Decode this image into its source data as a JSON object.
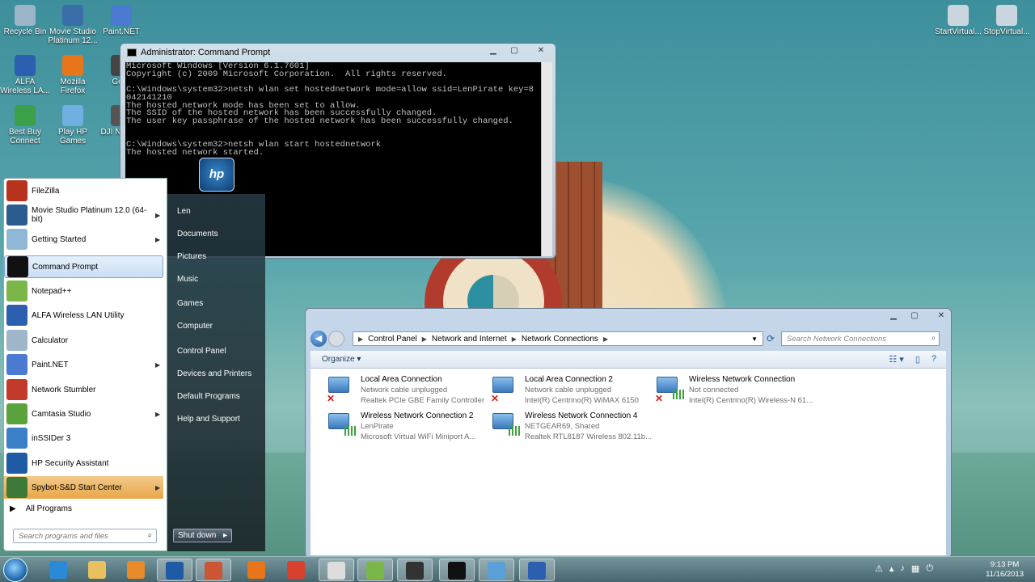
{
  "desktop": {
    "icons": [
      {
        "label": "Recycle Bin",
        "color": "#9ab4c8"
      },
      {
        "label": "Movie Studio Platinum 12...",
        "color": "#3a6ea8"
      },
      {
        "label": "Paint.NET",
        "color": "#4a7bd0"
      },
      {
        "label": "ALFA Wireless LA...",
        "color": "#2c5fb0"
      },
      {
        "label": "Mozilla Firefox",
        "color": "#e8751a"
      },
      {
        "label": "GoPr",
        "color": "#444444"
      },
      {
        "label": "Best Buy Connect",
        "color": "#3aa04a"
      },
      {
        "label": "Play HP Games",
        "color": "#6fb0e0"
      },
      {
        "label": "DJI N Assis",
        "color": "#555555"
      },
      {
        "label": "StartVirtual...",
        "color": "#c9d6e0"
      },
      {
        "label": "StopVirtual...",
        "color": "#c9d6e0"
      }
    ]
  },
  "cmd": {
    "title": "Administrator: Command Prompt",
    "minimize": "▁",
    "maximize": "▢",
    "close": "✕",
    "lines": "Microsoft Windows [Version 6.1.7601]\nCopyright (c) 2009 Microsoft Corporation.  All rights reserved.\n\nC:\\Windows\\system32>netsh wlan set hostednetwork mode=allow ssid=LenPirate key=8\n042141210\nThe hosted network mode has been set to allow.\nThe SSID of the hosted network has been successfully changed.\nThe user key passphrase of the hosted network has been successfully changed.\n\n\nC:\\Windows\\system32>netsh wlan start hostednetwork\nThe hosted network started."
  },
  "start_menu": {
    "pinned": [
      {
        "label": "FileZilla",
        "color": "#b8331e",
        "arrow": ""
      },
      {
        "label": "Movie Studio Platinum 12.0 (64-bit)",
        "color": "#2b5c8e",
        "arrow": "▶"
      },
      {
        "label": "Getting Started",
        "color": "#8fb7d6",
        "arrow": "▶"
      },
      {
        "label": "Command Prompt",
        "color": "#111111",
        "arrow": ""
      },
      {
        "label": "Notepad++",
        "color": "#7ab648",
        "arrow": ""
      },
      {
        "label": "ALFA Wireless LAN Utility",
        "color": "#2c5fb0",
        "arrow": ""
      },
      {
        "label": "Calculator",
        "color": "#9fb6c9",
        "arrow": ""
      },
      {
        "label": "Paint.NET",
        "color": "#4a7bd0",
        "arrow": "▶"
      },
      {
        "label": "Network Stumbler",
        "color": "#c23a2a",
        "arrow": ""
      },
      {
        "label": "Camtasia Studio",
        "color": "#5aa33c",
        "arrow": "▶"
      },
      {
        "label": "inSSIDer 3",
        "color": "#3a7fc8",
        "arrow": ""
      },
      {
        "label": "HP Security Assistant",
        "color": "#1f5aa5",
        "arrow": ""
      },
      {
        "label": "Spybot-S&D Start Center",
        "color": "#3d7a3a",
        "arrow": "▶"
      }
    ],
    "all_programs": "All Programs",
    "search_placeholder": "Search programs and files",
    "right": [
      "Len",
      "Documents",
      "Pictures",
      "Music",
      "Games",
      "Computer",
      "Control Panel",
      "Devices and Printers",
      "Default Programs",
      "Help and Support"
    ],
    "shutdown": "Shut down",
    "hp_logo_text": "hp"
  },
  "network": {
    "breadcrumb": [
      "Control Panel",
      "Network and Internet",
      "Network Connections"
    ],
    "search_placeholder": "Search Network Connections",
    "organize": "Organize",
    "connections": [
      {
        "name": "Local Area Connection",
        "status": "Network cable unplugged",
        "device": "Realtek PCIe GBE Family Controller",
        "state": "x"
      },
      {
        "name": "Local Area Connection 2",
        "status": "Network cable unplugged",
        "device": "Intel(R) Centrino(R) WiMAX 6150",
        "state": "x"
      },
      {
        "name": "Wireless Network Connection",
        "status": "Not connected",
        "device": "Intel(R) Centrino(R) Wireless-N 61...",
        "state": "x-sig"
      },
      {
        "name": "Wireless Network Connection 2",
        "status": "LenPirate",
        "device": "Microsoft Virtual WiFi Miniport A...",
        "state": "sig"
      },
      {
        "name": "Wireless Network Connection 4",
        "status": "NETGEAR69, Shared",
        "device": "Realtek RTL8187 Wireless 802.11b...",
        "state": "sig"
      }
    ]
  },
  "taskbar": {
    "apps": [
      {
        "name": "internet-explorer",
        "color": "#2a8ad8"
      },
      {
        "name": "explorer",
        "color": "#e8c060"
      },
      {
        "name": "media-player",
        "color": "#e88a2a"
      },
      {
        "name": "hp",
        "color": "#1f5aa5"
      },
      {
        "name": "printer",
        "color": "#cc5533"
      },
      {
        "name": "firefox",
        "color": "#e8751a"
      },
      {
        "name": "chrome",
        "color": "#d9412e"
      },
      {
        "name": "notepad",
        "color": "#dddddd"
      },
      {
        "name": "camtasia",
        "color": "#7ab648"
      },
      {
        "name": "dji",
        "color": "#333333"
      },
      {
        "name": "cmd",
        "color": "#111111"
      },
      {
        "name": "network",
        "color": "#5aa0d8"
      },
      {
        "name": "alfa",
        "color": "#2c5fb0"
      }
    ],
    "time": "9:13 PM",
    "date": "11/16/2013"
  }
}
